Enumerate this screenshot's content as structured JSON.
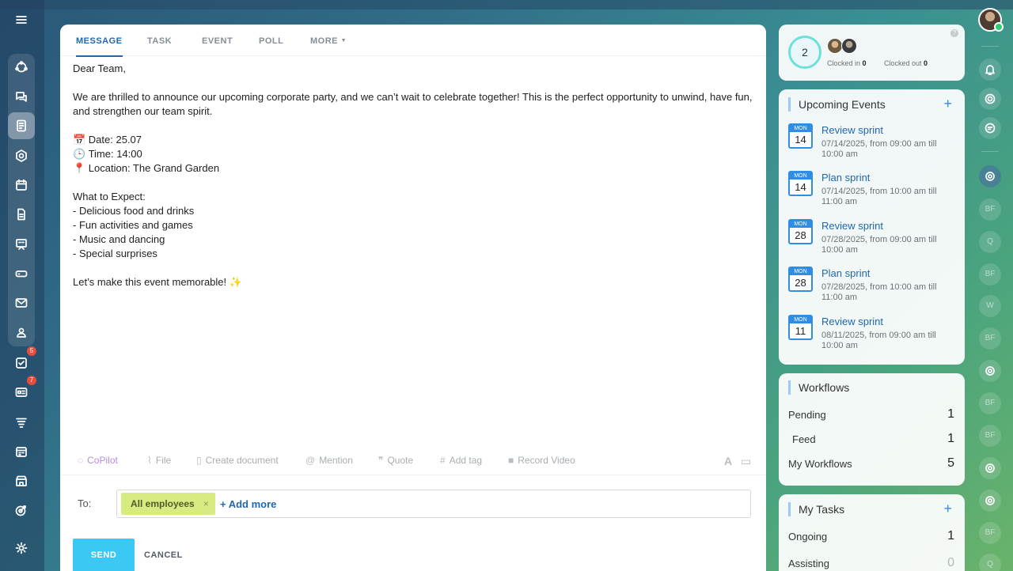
{
  "composer": {
    "tabs": [
      {
        "label": "MESSAGE",
        "active": true
      },
      {
        "label": "TASK"
      },
      {
        "label": "EVENT"
      },
      {
        "label": "POLL"
      },
      {
        "label": "MORE"
      }
    ],
    "body_lines": [
      "Dear Team,",
      "",
      "We are thrilled to announce our upcoming corporate party, and we can’t wait to celebrate together! This is the perfect opportunity to unwind, have fun, and strengthen our team spirit.",
      "",
      "📅 Date: 25.07",
      "🕒 Time: 14:00",
      "📍 Location: The Grand Garden",
      "",
      "What to Expect:",
      "- Delicious food and drinks",
      "- Fun activities and games",
      "- Music and dancing",
      "- Special surprises",
      "",
      "Let’s make this event memorable! ✨"
    ],
    "toolbar": {
      "copilot": "CoPilot",
      "file": "File",
      "create_document": "Create document",
      "mention": "Mention",
      "quote": "Quote",
      "add_tag": "Add tag",
      "record_video": "Record Video",
      "font_glyph": "A"
    },
    "to_label": "To:",
    "recipient_chip": "All employees",
    "add_more": "+ Add more",
    "send_label": "SEND",
    "cancel_label": "CANCEL"
  },
  "left_nav": {
    "badges": {
      "tasks": "5",
      "feed": "7"
    }
  },
  "timeman": {
    "count": "2",
    "clocked_in_label": "Clocked in",
    "clocked_in_value": "0",
    "clocked_out_label": "Clocked out",
    "clocked_out_value": "0",
    "help": "?"
  },
  "upcoming_events": {
    "title": "Upcoming Events",
    "add": "+",
    "items": [
      {
        "dow": "MON",
        "day": "14",
        "title": "Review sprint",
        "desc": "07/14/2025, from 09:00 am till 10:00 am"
      },
      {
        "dow": "MON",
        "day": "14",
        "title": "Plan sprint",
        "desc": "07/14/2025, from 10:00 am till 11:00 am"
      },
      {
        "dow": "MON",
        "day": "28",
        "title": "Review sprint",
        "desc": "07/28/2025, from 09:00 am till 10:00 am"
      },
      {
        "dow": "MON",
        "day": "28",
        "title": "Plan sprint",
        "desc": "07/28/2025, from 10:00 am till 11:00 am"
      },
      {
        "dow": "MON",
        "day": "11",
        "title": "Review sprint",
        "desc": "08/11/2025, from 09:00 am till 10:00 am"
      }
    ]
  },
  "workflows": {
    "title": "Workflows",
    "rows": [
      {
        "label": "Pending",
        "count": "1"
      },
      {
        "label": "Feed",
        "count": "1"
      },
      {
        "label": "My Workflows",
        "count": "5"
      }
    ]
  },
  "my_tasks": {
    "title": "My Tasks",
    "add": "+",
    "rows": [
      {
        "label": "Ongoing",
        "count": "1"
      },
      {
        "label": "Assisting",
        "count": "0"
      }
    ]
  },
  "right_rail": {
    "avatars": [
      "BF",
      "Q",
      "BF",
      "W",
      "BF",
      "BF",
      "BF",
      "BF",
      "Q"
    ]
  }
}
